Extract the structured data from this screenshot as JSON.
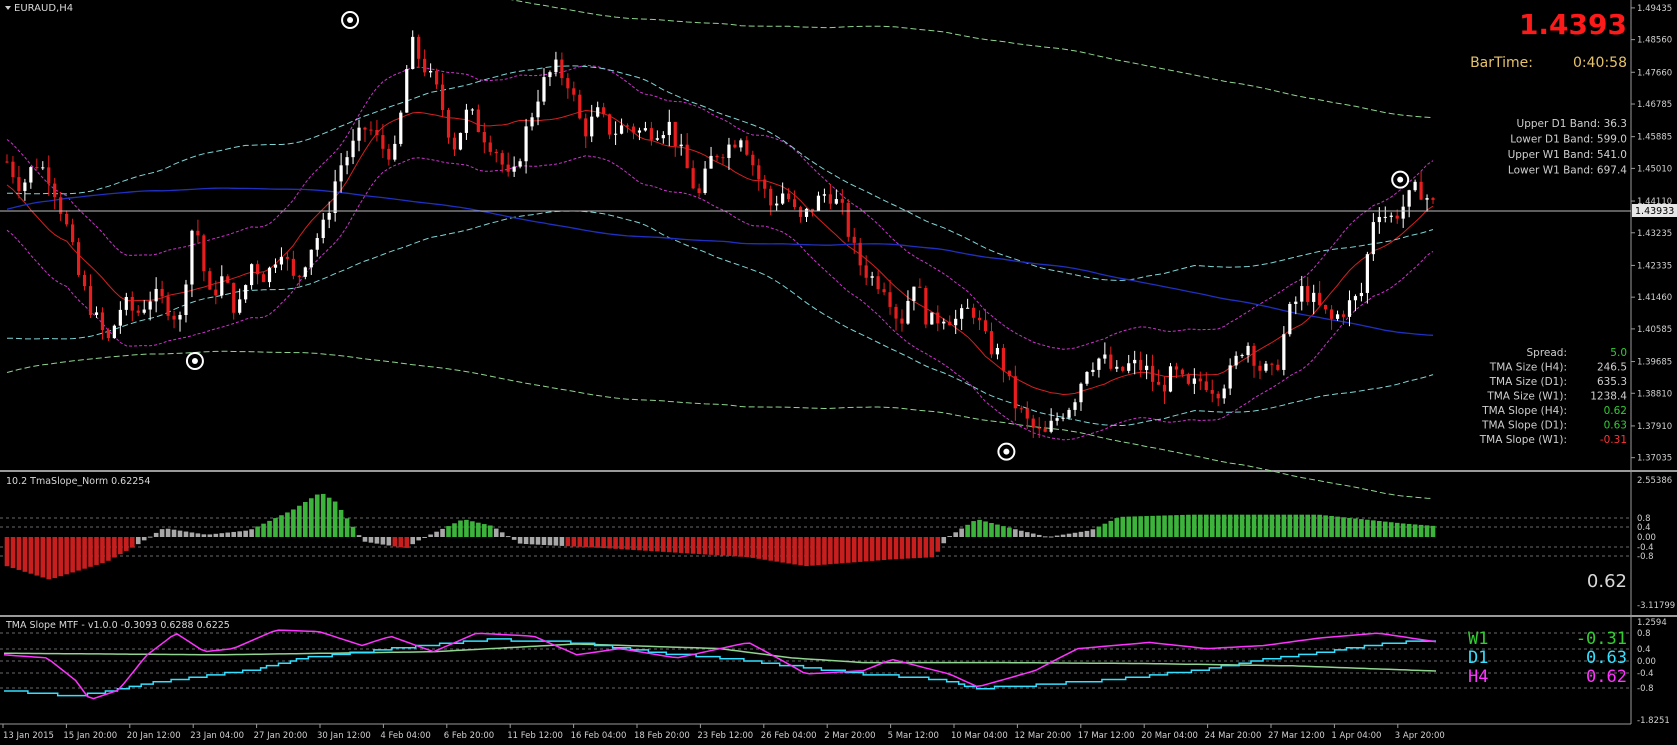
{
  "window": {
    "symbol_title": "EURAUD,H4",
    "price_big": "1.4393",
    "bartime_label": "BarTime:",
    "bartime_value": "0:40:58",
    "current_price_tag": "1.43933"
  },
  "bands_info": [
    {
      "label": "Upper D1 Band:",
      "value": "36.3"
    },
    {
      "label": "Lower D1 Band:",
      "value": "599.0"
    },
    {
      "label": "Upper W1 Band:",
      "value": "541.0"
    },
    {
      "label": "Lower W1 Band:",
      "value": "697.4"
    }
  ],
  "stats": [
    {
      "label": "Spread:",
      "value": "5.0",
      "color": "#33cc33"
    },
    {
      "label": "TMA Size (H4):",
      "value": "246.5",
      "color": "#cfcfcf"
    },
    {
      "label": "TMA Size (D1):",
      "value": "635.3",
      "color": "#cfcfcf"
    },
    {
      "label": "TMA Size (W1):",
      "value": "1238.4",
      "color": "#cfcfcf"
    },
    {
      "label": "TMA Slope (H4):",
      "value": "0.62",
      "color": "#33cc33"
    },
    {
      "label": "TMA Slope (D1):",
      "value": "0.63",
      "color": "#33cc33"
    },
    {
      "label": "TMA Slope (W1):",
      "value": "-0.31",
      "color": "#ff3333"
    }
  ],
  "subwindow1": {
    "title": "10.2 TmaSlope_Norm 0.62254",
    "value_text": "0.62",
    "axis_labels": [
      "2.55386",
      "0.8",
      "0.4",
      "0.00",
      "-0.4",
      "-0.8",
      "-3.11799"
    ]
  },
  "subwindow2": {
    "title": "TMA Slope MTF - v1.0.0 -0.3093 0.6288 0.6225",
    "axis_labels": [
      "1.2594",
      "0.8",
      "0.4",
      "0.00",
      "-0.4",
      "-0.8",
      "-1.8251"
    ],
    "legend": [
      {
        "label": "W1",
        "value": "-0.31",
        "color": "#33cc33"
      },
      {
        "label": "D1",
        "value": "0.63",
        "color": "#33e0ff"
      },
      {
        "label": "H4",
        "value": "0.62",
        "color": "#ff33ff"
      }
    ]
  },
  "colors": {
    "bull": "#ffffff",
    "bear": "#e81e1e",
    "tma_mid": "#d42020",
    "h4_band": "#cc33cc",
    "d1_band": "#7fd4d4",
    "w1_band": "#8fd48f",
    "blue_ma": "#2030c0",
    "hist_pos": "#3cb43c",
    "hist_neg": "#c81e1e",
    "hist_neutral": "#a8a8a8"
  },
  "chart_data": {
    "type": "candlestick",
    "title": "EURAUD,H4",
    "y_ticks": [
      "1.49435",
      "1.48560",
      "1.47660",
      "1.46785",
      "1.45885",
      "1.45010",
      "1.44110",
      "1.43235",
      "1.42335",
      "1.41460",
      "1.40585",
      "1.39685",
      "1.38810",
      "1.37910",
      "1.37035"
    ],
    "ylim": [
      1.3675,
      1.4957
    ],
    "x_tick_labels": [
      "13 Jan 2015",
      "15 Jan 20:00",
      "20 Jan 12:00",
      "23 Jan 04:00",
      "27 Jan 20:00",
      "30 Jan 12:00",
      "4 Feb 04:00",
      "6 Feb 20:00",
      "11 Feb 12:00",
      "16 Feb 04:00",
      "18 Feb 20:00",
      "23 Feb 12:00",
      "26 Feb 04:00",
      "2 Mar 20:00",
      "5 Mar 12:00",
      "10 Mar 04:00",
      "12 Mar 20:00",
      "17 Mar 12:00",
      "20 Mar 04:00",
      "24 Mar 20:00",
      "27 Mar 12:00",
      "1 Apr 04:00",
      "3 Apr 20:00"
    ],
    "close_path": [
      1.452,
      1.445,
      1.452,
      1.448,
      1.436,
      1.42,
      1.41,
      1.402,
      1.413,
      1.41,
      1.415,
      1.413,
      1.408,
      1.438,
      1.414,
      1.42,
      1.41,
      1.424,
      1.42,
      1.429,
      1.418,
      1.428,
      1.434,
      1.45,
      1.456,
      1.462,
      1.456,
      1.454,
      1.485,
      1.478,
      1.47,
      1.456,
      1.466,
      1.46,
      1.455,
      1.445,
      1.46,
      1.472,
      1.478,
      1.474,
      1.46,
      1.465,
      1.46,
      1.462,
      1.46,
      1.461,
      1.462,
      1.452,
      1.442,
      1.454,
      1.456,
      1.46,
      1.449,
      1.44,
      1.444,
      1.435,
      1.44,
      1.444,
      1.438,
      1.425,
      1.42,
      1.418,
      1.407,
      1.42,
      1.407,
      1.41,
      1.408,
      1.412,
      1.402,
      1.398,
      1.385,
      1.379,
      1.376,
      1.382,
      1.386,
      1.396,
      1.398,
      1.393,
      1.396,
      1.395,
      1.389,
      1.394,
      1.389,
      1.392,
      1.389,
      1.394,
      1.403,
      1.395,
      1.393,
      1.41,
      1.417,
      1.412,
      1.408,
      1.412,
      1.415,
      1.44,
      1.436,
      1.44,
      1.445,
      1.44
    ],
    "markers": [
      {
        "label": "high",
        "x_index": 29,
        "value": 1.491
      },
      {
        "label": "low",
        "x_index": 16,
        "value": 1.397
      },
      {
        "label": "low",
        "x_index": 84,
        "value": 1.372
      },
      {
        "label": "high",
        "x_index": 117,
        "value": 1.447
      }
    ],
    "series": [
      {
        "values": [
          0.62
        ],
        "color": "#ff33ff"
      },
      {
        "values": [
          0.63
        ],
        "color": "#33e0ff"
      },
      {
        "values": [
          -0.31
        ],
        "color": "#33cc33"
      }
    ],
    "grid": false
  }
}
